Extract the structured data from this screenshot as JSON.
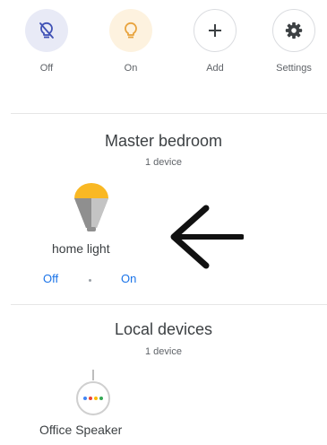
{
  "quick_actions": [
    {
      "label": "Off",
      "icon": "lightbulb-off-icon",
      "bg": "#e8eaf6",
      "color": "#3f51b5"
    },
    {
      "label": "On",
      "icon": "lightbulb-on-icon",
      "bg": "#fdf2df",
      "color": "#e8a33d"
    },
    {
      "label": "Add",
      "icon": "plus-icon",
      "bg": "#ffffff",
      "color": "#3c4043"
    },
    {
      "label": "Settings",
      "icon": "gear-icon",
      "bg": "#ffffff",
      "color": "#3c4043"
    }
  ],
  "rooms": [
    {
      "name": "Master bedroom",
      "device_count": "1 device",
      "devices": [
        {
          "name": "home light",
          "icon": "smart-bulb-icon",
          "controls": {
            "off": "Off",
            "on": "On"
          }
        }
      ]
    },
    {
      "name": "Local devices",
      "device_count": "1 device",
      "devices": [
        {
          "name": "Office Speaker",
          "icon": "smart-speaker-icon"
        }
      ]
    }
  ],
  "annotation": {
    "icon": "left-arrow-icon",
    "color": "#111111"
  },
  "colors": {
    "accent": "#1a73e8",
    "bulb_yellow": "#f9b824",
    "bulb_gray": "#9e9e9e"
  }
}
